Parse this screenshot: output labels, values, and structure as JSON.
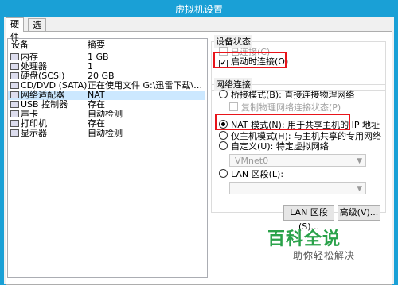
{
  "window": {
    "title": "虚拟机设置"
  },
  "tabs": [
    {
      "label": "硬件"
    },
    {
      "label": "选项"
    }
  ],
  "device_list": {
    "col_device": "设备",
    "col_summary": "摘要",
    "rows": [
      {
        "name": "内存",
        "summary": "1 GB",
        "icon": "memory-icon"
      },
      {
        "name": "处理器",
        "summary": "1",
        "icon": "processor-icon"
      },
      {
        "name": "硬盘(SCSI)",
        "summary": "20 GB",
        "icon": "hard-disk-icon"
      },
      {
        "name": "CD/DVD (SATA)",
        "summary": "正在使用文件 G:\\迅雷下载\\rhel-serv...",
        "icon": "cd-dvd-icon"
      },
      {
        "name": "网络适配器",
        "summary": "NAT",
        "icon": "network-adapter-icon"
      },
      {
        "name": "USB 控制器",
        "summary": "存在",
        "icon": "usb-icon"
      },
      {
        "name": "声卡",
        "summary": "自动检测",
        "icon": "sound-card-icon"
      },
      {
        "name": "打印机",
        "summary": "存在",
        "icon": "printer-icon"
      },
      {
        "name": "显示器",
        "summary": "自动检测",
        "icon": "display-icon"
      }
    ]
  },
  "device_status": {
    "title": "设备状态",
    "connected": "已连接(C)",
    "connect_on_power": "启动时连接(O)"
  },
  "network": {
    "title": "网络连接",
    "bridged": "桥接模式(B): 直接连接物理网络",
    "replicate": "复制物理网络连接状态(P)",
    "nat": "NAT 模式(N): 用于共享主机的 IP 地址",
    "host_only": "仅主机模式(H): 与主机共享的专用网络",
    "custom": "自定义(U): 特定虚拟网络",
    "vmnet": "VMnet0",
    "lan_segment": "LAN 区段(L):"
  },
  "buttons": {
    "lan_segments": "LAN 区段(S)...",
    "advanced": "高级(V)..."
  },
  "watermark": {
    "main": "百科全说",
    "sub": "助你轻松解决"
  },
  "colors": {
    "titlebar": "#1aa0d6",
    "highlight": "#e8141a",
    "watermark": "#2aa24a"
  }
}
